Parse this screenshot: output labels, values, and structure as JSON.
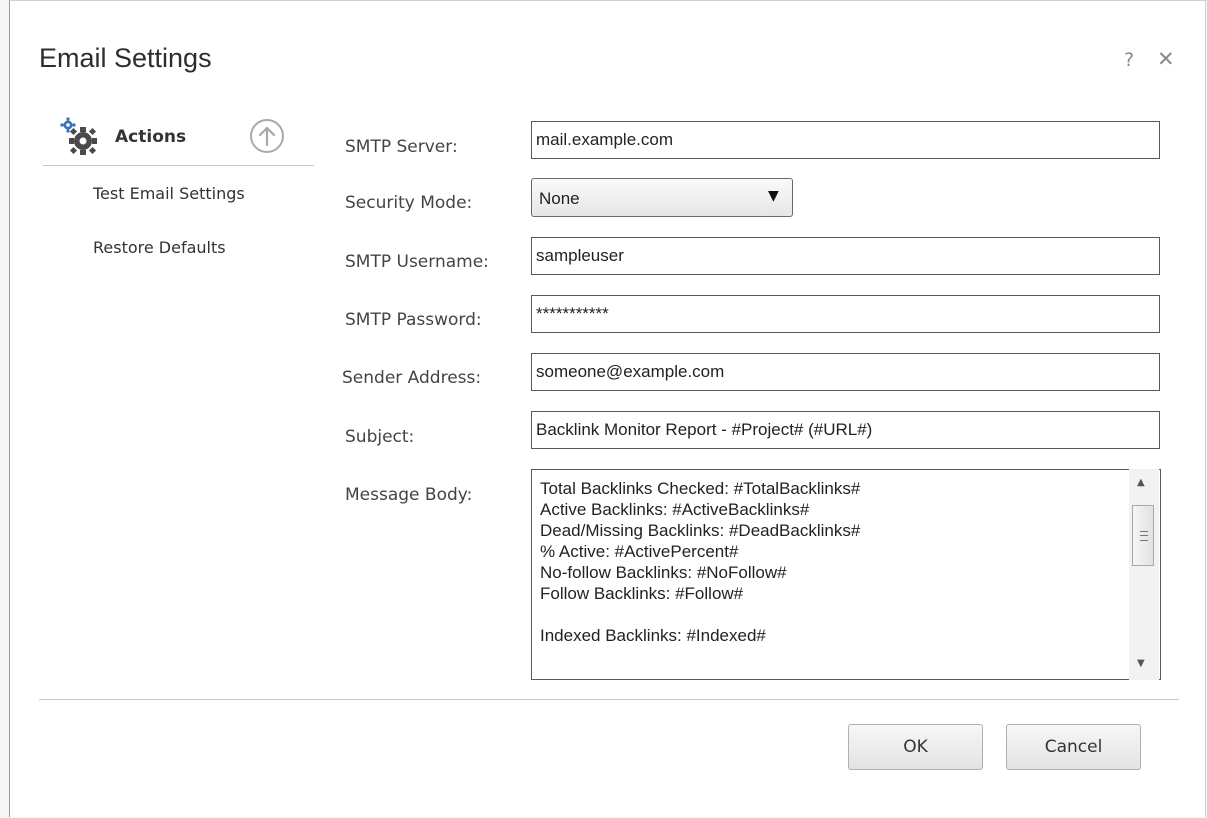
{
  "dialog": {
    "title": "Email Settings",
    "help_glyph": "?",
    "close_glyph": "✕"
  },
  "sidebar": {
    "header": "Actions",
    "header_icon": "gears-icon",
    "collapse_icon": "circle-up-arrow-icon",
    "items": [
      {
        "label": "Test Email Settings"
      },
      {
        "label": "Restore Defaults"
      }
    ]
  },
  "form": {
    "smtp_server": {
      "label": "SMTP Server:",
      "value": "mail.example.com"
    },
    "security_mode": {
      "label": "Security Mode:",
      "value": "None"
    },
    "smtp_username": {
      "label": "SMTP Username:",
      "value": "sampleuser"
    },
    "smtp_password": {
      "label": "SMTP Password:",
      "value": "***********"
    },
    "sender_address": {
      "label": "Sender Address:",
      "value": "someone@example.com"
    },
    "subject": {
      "label": "Subject:",
      "value": "Backlink Monitor Report - #Project# (#URL#)"
    },
    "message_body": {
      "label": "Message Body:",
      "lines": [
        "Total Backlinks Checked: #TotalBacklinks#",
        "Active Backlinks: #ActiveBacklinks#",
        "Dead/Missing Backlinks: #DeadBacklinks#",
        "% Active: #ActivePercent#",
        "No-follow Backlinks: #NoFollow#",
        "Follow Backlinks: #Follow#",
        "",
        "Indexed Backlinks: #Indexed#"
      ]
    }
  },
  "buttons": {
    "ok": "OK",
    "cancel": "Cancel"
  },
  "colors": {
    "accent_icon": "#3a73b8",
    "gear": "#4a4a4a"
  }
}
